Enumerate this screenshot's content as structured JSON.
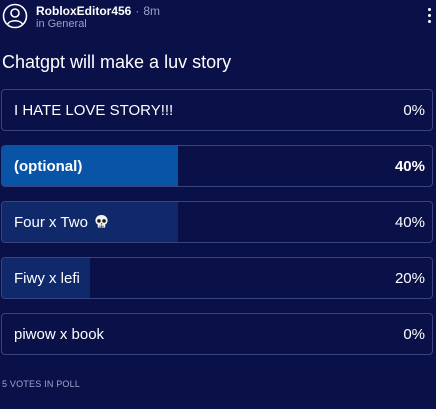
{
  "post": {
    "author": "RobloxEditor456",
    "separator": "·",
    "time": "8m",
    "community": "in General",
    "avatar_icon": "user-circle-icon",
    "menu_icon": "vertical-dots-icon"
  },
  "poll": {
    "title": "Chatgpt will make a luv story",
    "options": [
      {
        "label": "I HATE LOVE STORY!!!",
        "percent": "0%",
        "value": 0,
        "selected": false
      },
      {
        "label": "(optional)",
        "percent": "40%",
        "value": 0.4,
        "selected": true
      },
      {
        "label": "Four x Two",
        "percent": "40%",
        "value": 0.4,
        "selected": false,
        "icon": "skull-icon"
      },
      {
        "label": "Fiwy x lefi",
        "percent": "20%",
        "value": 0.2,
        "selected": false
      },
      {
        "label": "piwow x book",
        "percent": "0%",
        "value": 0,
        "selected": false
      }
    ],
    "votes_label": "5 VOTES IN POLL"
  },
  "colors": {
    "background": "#0a1048",
    "selected_fill": "#0a54a8",
    "result_fill": "#10296b",
    "border": "#3a4380",
    "muted_text": "#9aa0c8"
  }
}
